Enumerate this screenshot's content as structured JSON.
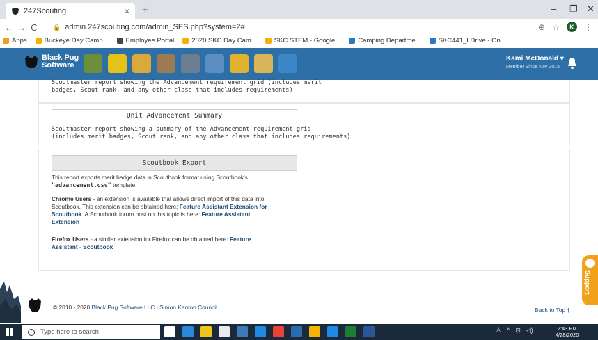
{
  "browser": {
    "tab_title": "247Scouting",
    "tab_close": "×",
    "new_tab": "+",
    "min": "–",
    "restore": "❐",
    "close": "✕",
    "back": "←",
    "forward": "→",
    "reload": "C",
    "url": "admin.247scouting.com/admin_SES.php?system=2#",
    "profile_initial": "K",
    "bookmarks": [
      {
        "label": "Apps",
        "color": "#e8a020"
      },
      {
        "label": "Buckeye Day Camp...",
        "color": "#f2b400"
      },
      {
        "label": "Employee Portal",
        "color": "#444444"
      },
      {
        "label": "2020 SKC Day Cam...",
        "color": "#f2b400"
      },
      {
        "label": "SKC STEM - Google...",
        "color": "#f2b400"
      },
      {
        "label": "Camping Departme...",
        "color": "#2b78c2"
      },
      {
        "label": "SKC441_LDrive - On...",
        "color": "#2b78c2"
      }
    ]
  },
  "header": {
    "logo_line1": "Black Pug",
    "logo_line2": "Software",
    "user_name": "Kami McDonald ▾",
    "member_since": "Member Since  Nov 2015",
    "icon_colors": [
      "#6b8f3a",
      "#e3c21a",
      "#d9a93a",
      "#9c7a52",
      "#6d7f8f",
      "#5b8fc4",
      "#e0b22f",
      "#d9b55a",
      "#3d86c8"
    ]
  },
  "panels": {
    "top_desc_line1": "Scoutmaster report showing the Advancement requirement grid (includes merit",
    "top_desc_line2": "badges, Scout rank, and any other class that includes requirements)",
    "unit_btn": "Unit Advancement Summary",
    "unit_desc_line1": "Scoutmaster report showing a summary of the Advancement requirement grid",
    "unit_desc_line2": "(includes merit badges, Scout rank, and any other class that includes requirements)",
    "export_btn": "Scoutbook Export",
    "export_desc_1": "This report exports merit badge data in Scoutbook format using Scoutbook's",
    "export_desc_file": "\"advancement.csv\"",
    "export_desc_2": " template.",
    "chrome_bold": "Chrome Users",
    "chrome_text1": " - an extension is available that allows direct import of this data into",
    "chrome_text2": "Scoutbook. This extension can be obtained here: ",
    "chrome_link1": "Feature Assistant Extension for",
    "chrome_link1b": "Scoutbook",
    "chrome_text3": ". A Scoutbook forum post on this topic is here: ",
    "chrome_link2": "Feature Assistant",
    "chrome_link2b": "Extension",
    "firefox_bold": "Firefox Users",
    "firefox_text": " - a similar extension for Firefox can be obtained here: ",
    "firefox_link": "Feature",
    "firefox_link2": "Assistant - Scoutbook"
  },
  "footer": {
    "copyright": "© 2010 - 2020 ",
    "company": "Black Pug Software LLC",
    "sep": "  |  ",
    "council": "Simon Kenton Council",
    "back_to_top": "Back to Top 🠕"
  },
  "support": {
    "label": "Support"
  },
  "taskbar": {
    "search_placeholder": "Type here to search",
    "time": "2:43 PM",
    "date": "4/28/2020",
    "app_colors": [
      "#ffffff",
      "#2b88d8",
      "#f0c419",
      "#e8eaed",
      "#3d7ab8",
      "#1e88e5",
      "#ea4335",
      "#2b6cb0",
      "#f5b400",
      "#1e88e5",
      "#1e7e34",
      "#2b5797"
    ]
  }
}
